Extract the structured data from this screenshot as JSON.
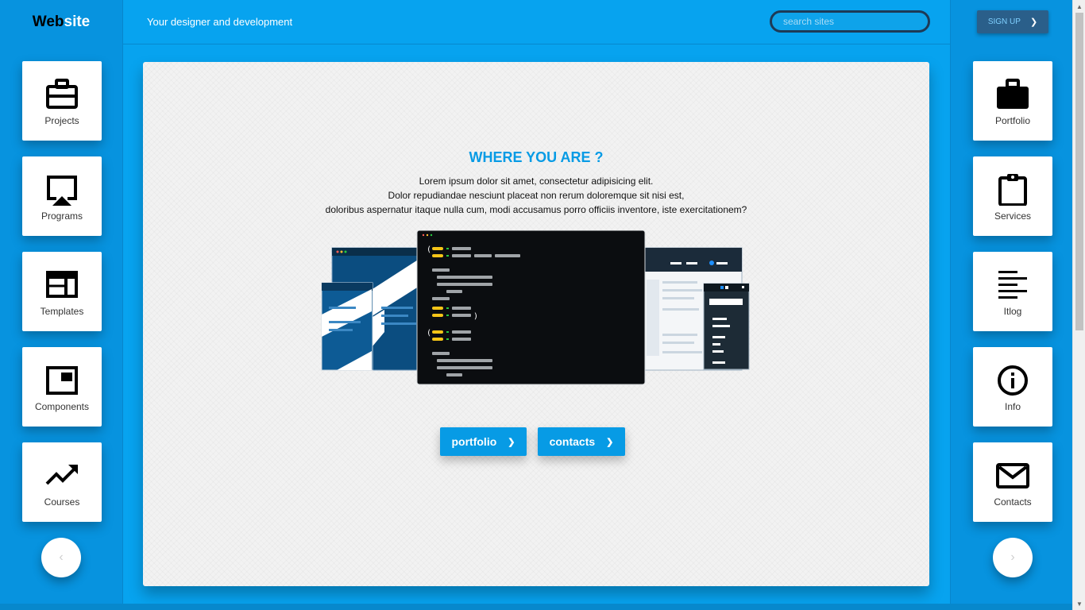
{
  "header": {
    "logo_part1": "Web",
    "logo_part2": "site",
    "tagline": "Your designer and development",
    "search_placeholder": "search sites",
    "signup_label": "SIGN UP",
    "signup_chevron": "❯"
  },
  "left_nav": [
    {
      "label": "Projects",
      "icon": "briefcase-outline-icon"
    },
    {
      "label": "Programs",
      "icon": "airplay-icon"
    },
    {
      "label": "Templates",
      "icon": "web-template-icon"
    },
    {
      "label": "Components",
      "icon": "picture-in-picture-icon"
    },
    {
      "label": "Courses",
      "icon": "trending-up-icon"
    }
  ],
  "right_nav": [
    {
      "label": "Portfolio",
      "icon": "briefcase-icon"
    },
    {
      "label": "Services",
      "icon": "clipboard-icon"
    },
    {
      "label": "Itlog",
      "icon": "text-lines-icon"
    },
    {
      "label": "Info",
      "icon": "info-icon"
    },
    {
      "label": "Contacts",
      "icon": "mail-icon"
    }
  ],
  "nav_controls": {
    "prev": "‹",
    "next": "›"
  },
  "main": {
    "title": "WHERE YOU ARE ?",
    "lines": [
      "Lorem ipsum dolor sit amet, consectetur adipisicing elit.",
      "Dolor repudiandae nesciunt placeat non rerum doloremque sit nisi est,",
      "doloribus aspernatur itaque nulla cum, modi accusamus porro officiis inventore, iste exercitationem?"
    ],
    "buttons": [
      {
        "label": "portfolio",
        "chevron": "❯"
      },
      {
        "label": "contacts",
        "chevron": "❯"
      }
    ],
    "code_parens": [
      "(",
      ")",
      "("
    ]
  },
  "colors": {
    "accent": "#079be5",
    "header_bg": "#07a3ef",
    "side_bg": "#0793df",
    "signup_bg": "#2a5f8a",
    "code_yellow": "#f5c518"
  }
}
